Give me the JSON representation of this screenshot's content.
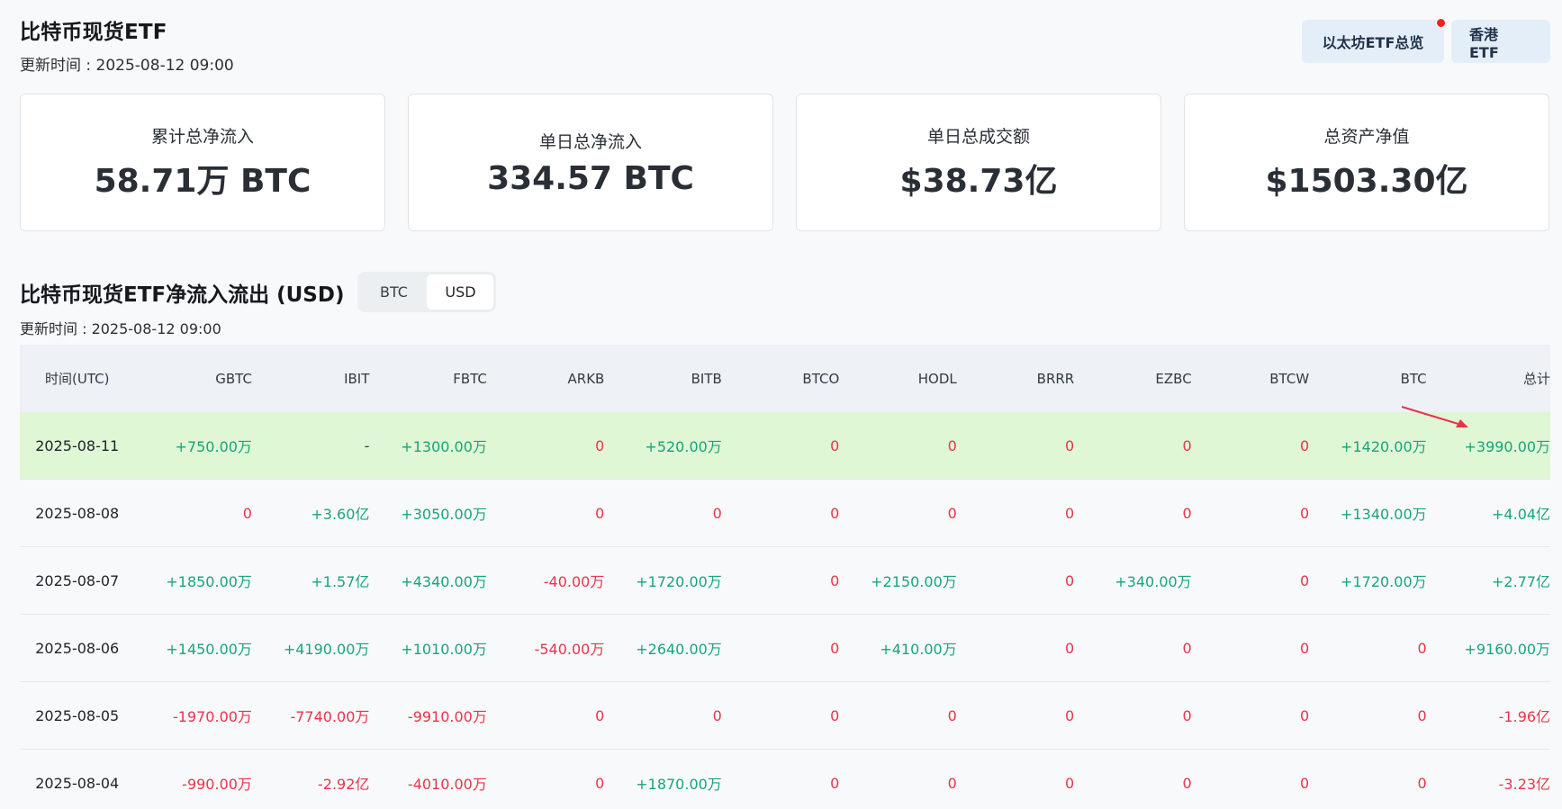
{
  "header": {
    "title": "比特币现货ETF",
    "updated": "更新时间 : 2025-08-12 09:00"
  },
  "top_buttons": {
    "eth_overview": "以太坊ETF总览",
    "hk_etf": "香港 ETF"
  },
  "stats": [
    {
      "label": "累计总净流入",
      "value": "58.71万 BTC"
    },
    {
      "label": "单日总净流入",
      "value": "334.57 BTC"
    },
    {
      "label": "单日总成交额",
      "value": "$38.73亿"
    },
    {
      "label": "总资产净值",
      "value": "$1503.30亿"
    }
  ],
  "section": {
    "title": "比特币现货ETF净流入流出 (USD)",
    "toggle": {
      "btc": "BTC",
      "usd": "USD",
      "active": "USD"
    },
    "updated": "更新时间 : 2025-08-12 09:00"
  },
  "colors": {
    "positive": "#18a47c",
    "negative": "#e8344b",
    "highlight": "#dff7d4",
    "accent": "#e3eef9"
  },
  "table": {
    "headers": [
      "时间(UTC)",
      "GBTC",
      "IBIT",
      "FBTC",
      "ARKB",
      "BITB",
      "BTCO",
      "HODL",
      "BRRR",
      "EZBC",
      "BTCW",
      "BTC",
      "总计"
    ],
    "rows": [
      [
        "2025-08-11",
        "+750.00万",
        "-",
        "+1300.00万",
        "0",
        "+520.00万",
        "0",
        "0",
        "0",
        "0",
        "0",
        "+1420.00万",
        "+3990.00万"
      ],
      [
        "2025-08-08",
        "0",
        "+3.60亿",
        "+3050.00万",
        "0",
        "0",
        "0",
        "0",
        "0",
        "0",
        "0",
        "+1340.00万",
        "+4.04亿"
      ],
      [
        "2025-08-07",
        "+1850.00万",
        "+1.57亿",
        "+4340.00万",
        "-40.00万",
        "+1720.00万",
        "0",
        "+2150.00万",
        "0",
        "+340.00万",
        "0",
        "+1720.00万",
        "+2.77亿"
      ],
      [
        "2025-08-06",
        "+1450.00万",
        "+4190.00万",
        "+1010.00万",
        "-540.00万",
        "+2640.00万",
        "0",
        "+410.00万",
        "0",
        "0",
        "0",
        "0",
        "+9160.00万"
      ],
      [
        "2025-08-05",
        "-1970.00万",
        "-7740.00万",
        "-9910.00万",
        "0",
        "0",
        "0",
        "0",
        "0",
        "0",
        "0",
        "0",
        "-1.96亿"
      ],
      [
        "2025-08-04",
        "-990.00万",
        "-2.92亿",
        "-4010.00万",
        "0",
        "+1870.00万",
        "0",
        "0",
        "0",
        "0",
        "0",
        "0",
        "-3.23亿"
      ]
    ]
  }
}
